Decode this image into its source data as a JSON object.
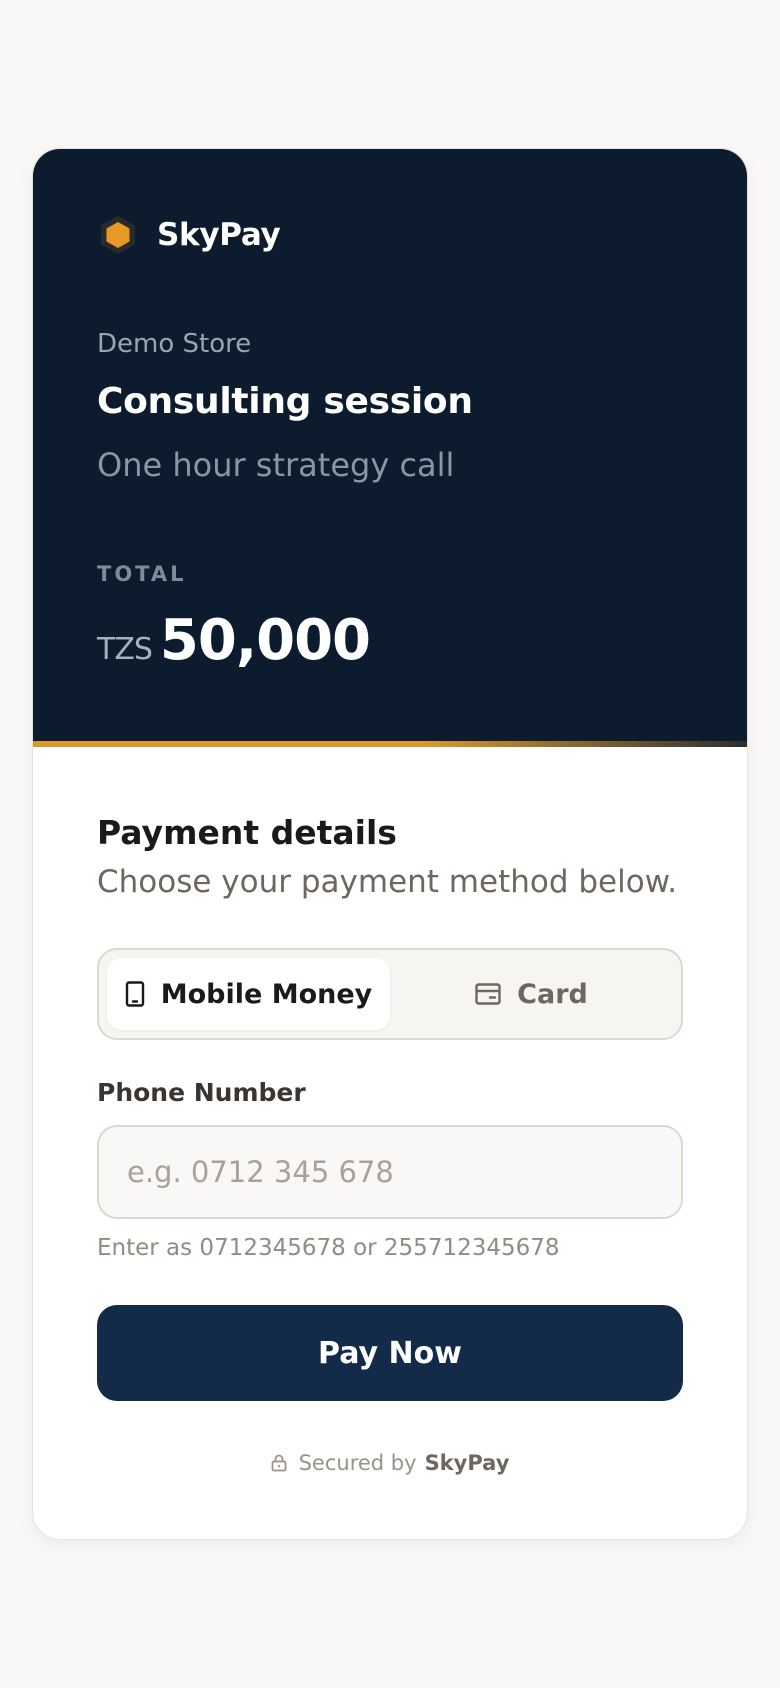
{
  "brand": {
    "name": "SkyPay",
    "logo_icon": "hexagon-logo-icon",
    "accent_color": "#d99a2b"
  },
  "order": {
    "merchant": "Demo Store",
    "title": "Consulting session",
    "description": "One hour strategy call",
    "total_label": "TOTAL",
    "currency": "TZS",
    "amount": "50,000"
  },
  "payment": {
    "title": "Payment details",
    "subtitle": "Choose your payment method below.",
    "methods": [
      {
        "label": "Mobile Money",
        "icon": "smartphone-icon",
        "active": true
      },
      {
        "label": "Card",
        "icon": "credit-card-icon",
        "active": false
      }
    ],
    "phone": {
      "label": "Phone Number",
      "placeholder": "e.g. 0712 345 678",
      "value": "",
      "hint": "Enter as 0712345678 or 255712345678"
    },
    "submit_label": "Pay Now",
    "primary_color": "#132b48"
  },
  "footer": {
    "secured_text": "Secured by",
    "secured_brand": "SkyPay",
    "icon": "lock-icon"
  }
}
